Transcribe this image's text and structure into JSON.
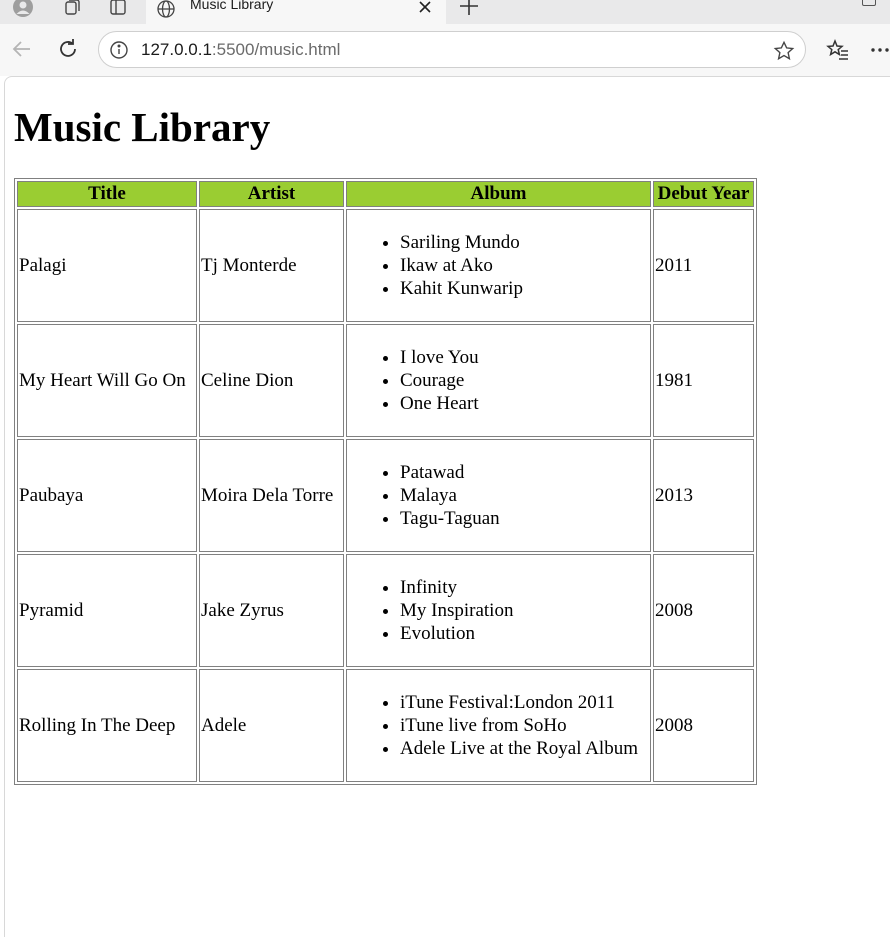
{
  "browser": {
    "tab_title": "Music Library",
    "url_host": "127.0.0.1",
    "url_rest": ":5500/music.html"
  },
  "page": {
    "heading": "Music Library",
    "columns": [
      "Title",
      "Artist",
      "Album",
      "Debut Year"
    ],
    "header_color": "#9acd32",
    "rows": [
      {
        "title": "Palagi",
        "artist": "Tj Monterde",
        "albums": [
          "Sariling Mundo",
          "Ikaw at Ako",
          "Kahit Kunwarip"
        ],
        "year": "2011"
      },
      {
        "title": "My Heart Will Go On",
        "artist": "Celine Dion",
        "albums": [
          "I love You",
          "Courage",
          "One Heart"
        ],
        "year": "1981"
      },
      {
        "title": "Paubaya",
        "artist": "Moira Dela Torre",
        "albums": [
          "Patawad",
          "Malaya",
          "Tagu-Taguan"
        ],
        "year": "2013"
      },
      {
        "title": "Pyramid",
        "artist": "Jake Zyrus",
        "albums": [
          "Infinity",
          "My Inspiration",
          "Evolution"
        ],
        "year": "2008"
      },
      {
        "title": "Rolling In The Deep",
        "artist": "Adele",
        "albums": [
          "iTune Festival:London 2011",
          "iTune live from SoHo",
          "Adele Live at the Royal Album"
        ],
        "year": "2008"
      }
    ]
  }
}
